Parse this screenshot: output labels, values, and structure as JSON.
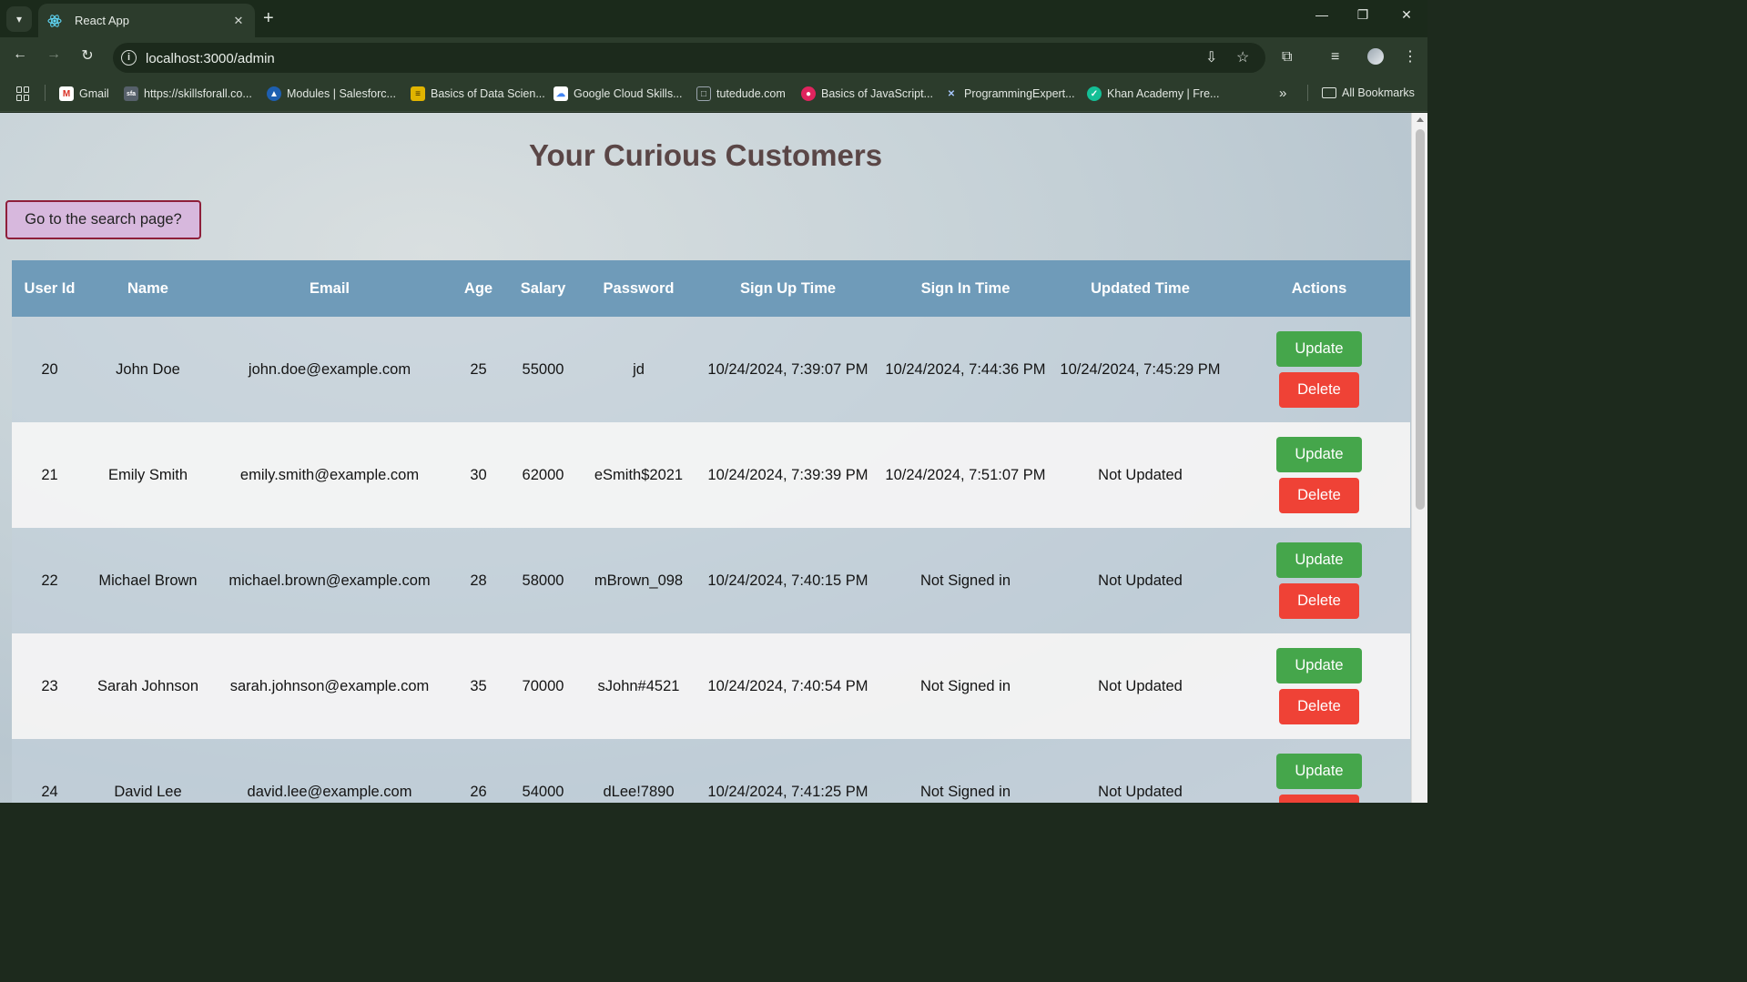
{
  "browser": {
    "tab_title": "React App",
    "url": "localhost:3000/admin",
    "bookmarks": [
      {
        "label": "Gmail",
        "icon": "gmail-icon"
      },
      {
        "label": "https://skillsforall.co...",
        "icon": "skillsforall-icon"
      },
      {
        "label": "Modules | Salesforc...",
        "icon": "salesforce-trailhead-icon"
      },
      {
        "label": "Basics of Data Scien...",
        "icon": "data-science-icon"
      },
      {
        "label": "Google Cloud Skills...",
        "icon": "google-cloud-icon"
      },
      {
        "label": "tutedude.com",
        "icon": "tutedude-icon"
      },
      {
        "label": "Basics of JavaScript...",
        "icon": "javascript-course-icon"
      },
      {
        "label": "ProgrammingExpert...",
        "icon": "programmingexpert-icon"
      },
      {
        "label": "Khan Academy | Fre...",
        "icon": "khan-academy-icon"
      }
    ],
    "all_bookmarks_label": "All Bookmarks"
  },
  "page": {
    "title": "Your Curious Customers",
    "search_button_label": "Go to the search page?"
  },
  "table": {
    "headers": [
      "User Id",
      "Name",
      "Email",
      "Age",
      "Salary",
      "Password",
      "Sign Up Time",
      "Sign In Time",
      "Updated Time",
      "Actions"
    ],
    "update_label": "Update",
    "delete_label": "Delete",
    "rows": [
      {
        "id": "20",
        "name": "John Doe",
        "email": "john.doe@example.com",
        "age": "25",
        "salary": "55000",
        "password": "jd",
        "signup": "10/24/2024, 7:39:07 PM",
        "signin": "10/24/2024, 7:44:36 PM",
        "updated": "10/24/2024, 7:45:29 PM"
      },
      {
        "id": "21",
        "name": "Emily Smith",
        "email": "emily.smith@example.com",
        "age": "30",
        "salary": "62000",
        "password": "eSmith$2021",
        "signup": "10/24/2024, 7:39:39 PM",
        "signin": "10/24/2024, 7:51:07 PM",
        "updated": "Not Updated"
      },
      {
        "id": "22",
        "name": "Michael Brown",
        "email": "michael.brown@example.com",
        "age": "28",
        "salary": "58000",
        "password": "mBrown_098",
        "signup": "10/24/2024, 7:40:15 PM",
        "signin": "Not Signed in",
        "updated": "Not Updated"
      },
      {
        "id": "23",
        "name": "Sarah Johnson",
        "email": "sarah.johnson@example.com",
        "age": "35",
        "salary": "70000",
        "password": "sJohn#4521",
        "signup": "10/24/2024, 7:40:54 PM",
        "signin": "Not Signed in",
        "updated": "Not Updated"
      },
      {
        "id": "24",
        "name": "David Lee",
        "email": "david.lee@example.com",
        "age": "26",
        "salary": "54000",
        "password": "dLee!7890",
        "signup": "10/24/2024, 7:41:25 PM",
        "signin": "Not Signed in",
        "updated": "Not Updated"
      }
    ]
  }
}
